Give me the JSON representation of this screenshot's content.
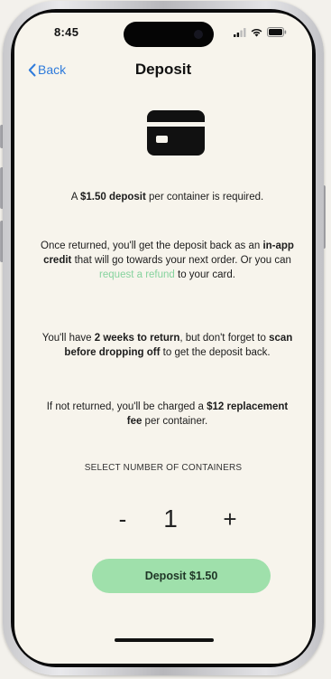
{
  "status_bar": {
    "time": "8:45",
    "icons": [
      "signal-icon",
      "wifi-icon",
      "battery-icon"
    ]
  },
  "nav": {
    "back_label": "Back",
    "title": "Deposit"
  },
  "content": {
    "icon": "credit-card-icon",
    "para1": {
      "t1": "A ",
      "b1": "$1.50 deposit",
      "t2": " per container is required."
    },
    "para2": {
      "t1": "Once returned, you'll get the deposit back as an ",
      "b1": "in-app credit",
      "t2": " that will go towards your next order. Or you can ",
      "link": "request a refund",
      "t3": " to your card."
    },
    "para3": {
      "t1": "You'll have ",
      "b1": "2 weeks to return",
      "t2": ", but don't forget to ",
      "b2": "scan before dropping off",
      "t3": " to get the deposit back."
    },
    "para4": {
      "t1": "If not returned, you'll be charged a ",
      "b1": "$12 replacement fee",
      "t2": " per container."
    }
  },
  "stepper": {
    "label": "SELECT NUMBER OF CONTAINERS",
    "minus": "-",
    "value": "1",
    "plus": "+"
  },
  "deposit_button": {
    "label": "Deposit $1.50"
  },
  "colors": {
    "background": "#f7f4ec",
    "accent_green": "#9fe0ab",
    "link_green": "#86d39e",
    "back_blue": "#2f7bdb"
  }
}
